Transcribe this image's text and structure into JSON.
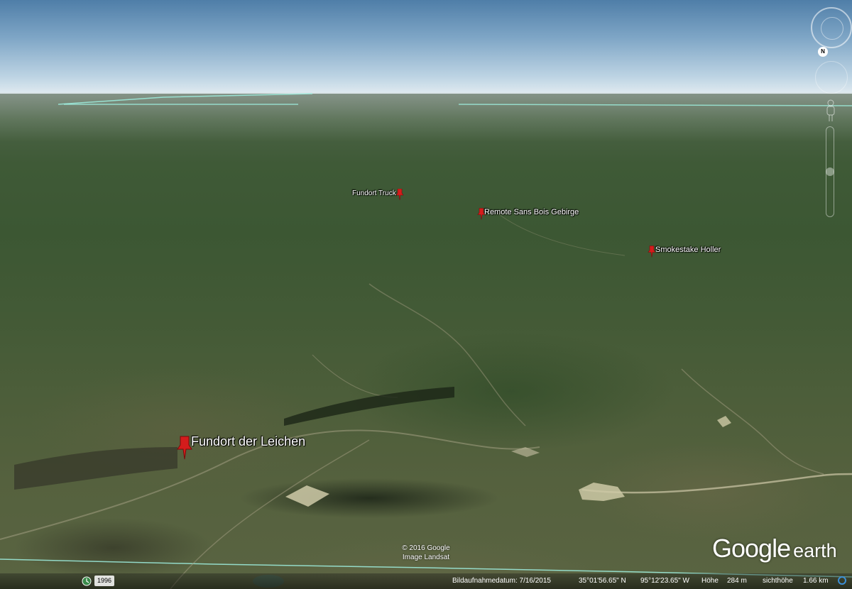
{
  "placemarks": [
    {
      "name": "Fundort Truck"
    },
    {
      "name": "Remote Sans Bois Gebirge"
    },
    {
      "name": "Smokestake Holler"
    },
    {
      "name": "Fundort der Leichen"
    }
  ],
  "navigation": {
    "north_label": "N"
  },
  "copyright": {
    "line1": "© 2016 Google",
    "line2": "Image Landsat"
  },
  "logo": {
    "word1": "Google",
    "word2": "earth"
  },
  "status_bar": {
    "history_year": "1996",
    "imagery_date": "Bildaufnahmedatum: 7/16/2015",
    "latitude": "35°01'56.65\" N",
    "longitude": "95°12'23.65\" W",
    "elevation_label": "Höhe",
    "elevation_value": "284 m",
    "eye_alt_label": "sichthöhe",
    "eye_alt_value": "1.66 km"
  },
  "colors": {
    "placemark_red": "#d41c1c",
    "boundary_line": "#9ff0e0",
    "loading_blue": "#3c8fd6"
  }
}
